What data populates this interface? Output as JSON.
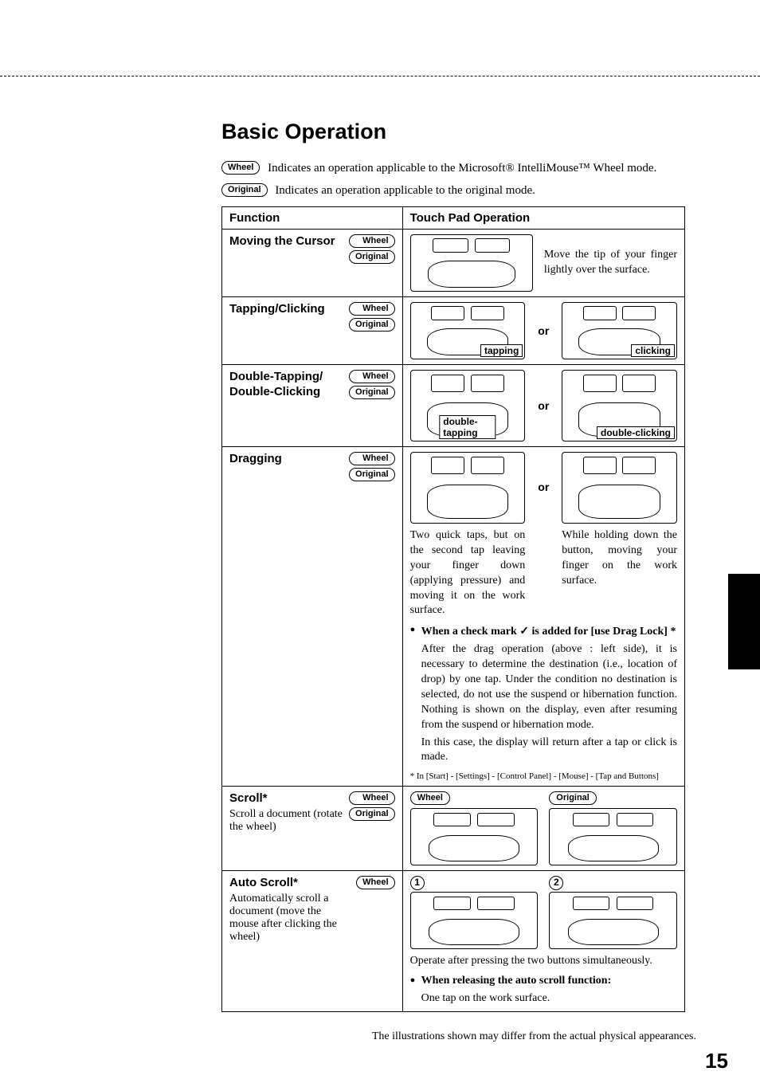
{
  "title": "Basic Operation",
  "intro": {
    "wheel_label": "Wheel",
    "wheel_text": "Indicates an operation applicable to the Microsoft® IntelliMouse™ Wheel mode.",
    "original_label": "Original",
    "original_text": "Indicates an operation applicable to the original mode."
  },
  "headers": {
    "function": "Function",
    "operation": "Touch Pad Operation"
  },
  "pills": {
    "wheel": "Wheel",
    "original": "Original"
  },
  "rows": {
    "move": {
      "title": "Moving the Cursor",
      "desc": "Move the tip of your finger lightly over the surface."
    },
    "tap": {
      "title": "Tapping/Clicking",
      "or": "or",
      "cap_tapping": "tapping",
      "cap_clicking": "clicking"
    },
    "double": {
      "title_a": "Double-Tapping/",
      "title_b": "Double-Clicking",
      "or": "or",
      "cap_dtapping": "double-tapping",
      "cap_dclicking": "double-clicking"
    },
    "drag": {
      "title": "Dragging",
      "or": "or",
      "left_text": "Two quick taps, but on the second tap leaving your finger down (applying pressure) and moving it on the work surface.",
      "right_text": "While holding down the button, moving your finger on the work surface.",
      "bullet1_a": "When a check mark ",
      "bullet1_b": " is added for [use Drag Lock] *",
      "check": "✓",
      "indent1": "After the drag operation (above : left side), it is necessary to determine the destination (i.e., location of drop) by one tap.  Under the condition no destination is selected, do not use the suspend or hibernation function.  Nothing is shown on the display, even after resuming from the suspend or hibernation mode.",
      "indent2": "In this case, the display will return after a tap or click is made.",
      "footnote": "* In [Start] - [Settings] - [Control Panel] - [Mouse] - [Tap and Buttons]"
    },
    "scroll": {
      "title": "Scroll*",
      "sub": "Scroll a document (rotate the wheel)",
      "pill_wheel": "Wheel",
      "pill_original": "Original"
    },
    "auto": {
      "title": "Auto Scroll*",
      "sub": "Automatically scroll a document (move the mouse after clicking the wheel)",
      "n1": "1",
      "n2": "2",
      "line1": "Operate after pressing the two buttons simultaneously.",
      "bullet": "When releasing the  auto scroll function:",
      "indent": "One tap on the work surface."
    }
  },
  "footer": "The illustrations shown may differ from the actual physical appearances.",
  "page_number": "15"
}
